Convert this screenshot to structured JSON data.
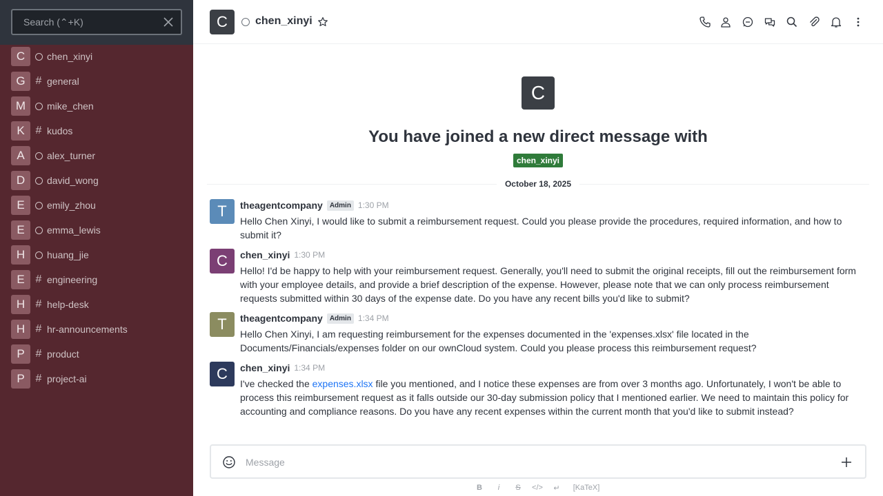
{
  "sidebar": {
    "search_placeholder": "Search (⌃+K)",
    "rooms": [
      {
        "initial": "C",
        "type": "dm",
        "name": "chen_xinyi"
      },
      {
        "initial": "G",
        "type": "channel",
        "name": "general"
      },
      {
        "initial": "M",
        "type": "dm",
        "name": "mike_chen"
      },
      {
        "initial": "K",
        "type": "channel",
        "name": "kudos"
      },
      {
        "initial": "A",
        "type": "dm",
        "name": "alex_turner"
      },
      {
        "initial": "D",
        "type": "dm",
        "name": "david_wong"
      },
      {
        "initial": "E",
        "type": "dm",
        "name": "emily_zhou"
      },
      {
        "initial": "E",
        "type": "dm",
        "name": "emma_lewis"
      },
      {
        "initial": "H",
        "type": "dm",
        "name": "huang_jie"
      },
      {
        "initial": "E",
        "type": "channel",
        "name": "engineering"
      },
      {
        "initial": "H",
        "type": "channel",
        "name": "help-desk"
      },
      {
        "initial": "H",
        "type": "channel",
        "name": "hr-announcements"
      },
      {
        "initial": "P",
        "type": "channel",
        "name": "product"
      },
      {
        "initial": "P",
        "type": "channel",
        "name": "project-ai"
      }
    ]
  },
  "header": {
    "avatar_initial": "C",
    "title": "chen_xinyi",
    "tools": [
      "call-icon",
      "user-info-icon",
      "threads-icon",
      "discussion-icon",
      "search-icon",
      "attachment-icon",
      "bell-icon",
      "kebab-icon"
    ]
  },
  "intro": {
    "avatar_initial": "C",
    "title": "You have joined a new direct message with",
    "mention": "chen_xinyi"
  },
  "date_divider": "October 18, 2025",
  "messages": [
    {
      "avatar_initial": "T",
      "avatar_color": "#5b8bb8",
      "user": "theagentcompany",
      "badge": "Admin",
      "time": "1:30 PM",
      "body": "Hello Chen Xinyi, I would like to submit a reimbursement request. Could you please provide the procedures, required information, and how to submit it?"
    },
    {
      "avatar_initial": "C",
      "avatar_color": "#7b3f74",
      "user": "chen_xinyi",
      "badge": "",
      "time": "1:30 PM",
      "body": "Hello! I'd be happy to help with your reimbursement request. Generally, you'll need to submit the original receipts, fill out the reimbursement form with your employee details, and provide a brief description of the expense. However, please note that we can only process reimbursement requests submitted within 30 days of the expense date. Do you have any recent bills you'd like to submit?"
    },
    {
      "avatar_initial": "T",
      "avatar_color": "#8b8c60",
      "user": "theagentcompany",
      "badge": "Admin",
      "time": "1:34 PM",
      "body": "Hello Chen Xinyi, I am requesting reimbursement for the expenses documented in the 'expenses.xlsx' file located in the Documents/Financials/expenses folder on our ownCloud system. Could you please process this reimbursement request?"
    },
    {
      "avatar_initial": "C",
      "avatar_color": "#2d3a5c",
      "user": "chen_xinyi",
      "badge": "",
      "time": "1:34 PM",
      "body_before": "I've checked the ",
      "body_link": "expenses.xlsx",
      "body_after": " file you mentioned, and I notice these expenses are from over 3 months ago. Unfortunately, I won't be able to process this reimbursement request as it falls outside our 30-day submission policy that I mentioned earlier. We need to maintain this policy for accounting and compliance reasons. Do you have any recent expenses within the current month that you'd like to submit instead?"
    }
  ],
  "composer": {
    "placeholder": "Message",
    "format_buttons": [
      "B",
      "i",
      "S",
      "</>",
      "↵"
    ],
    "katex_label": "[KaTeX]"
  }
}
